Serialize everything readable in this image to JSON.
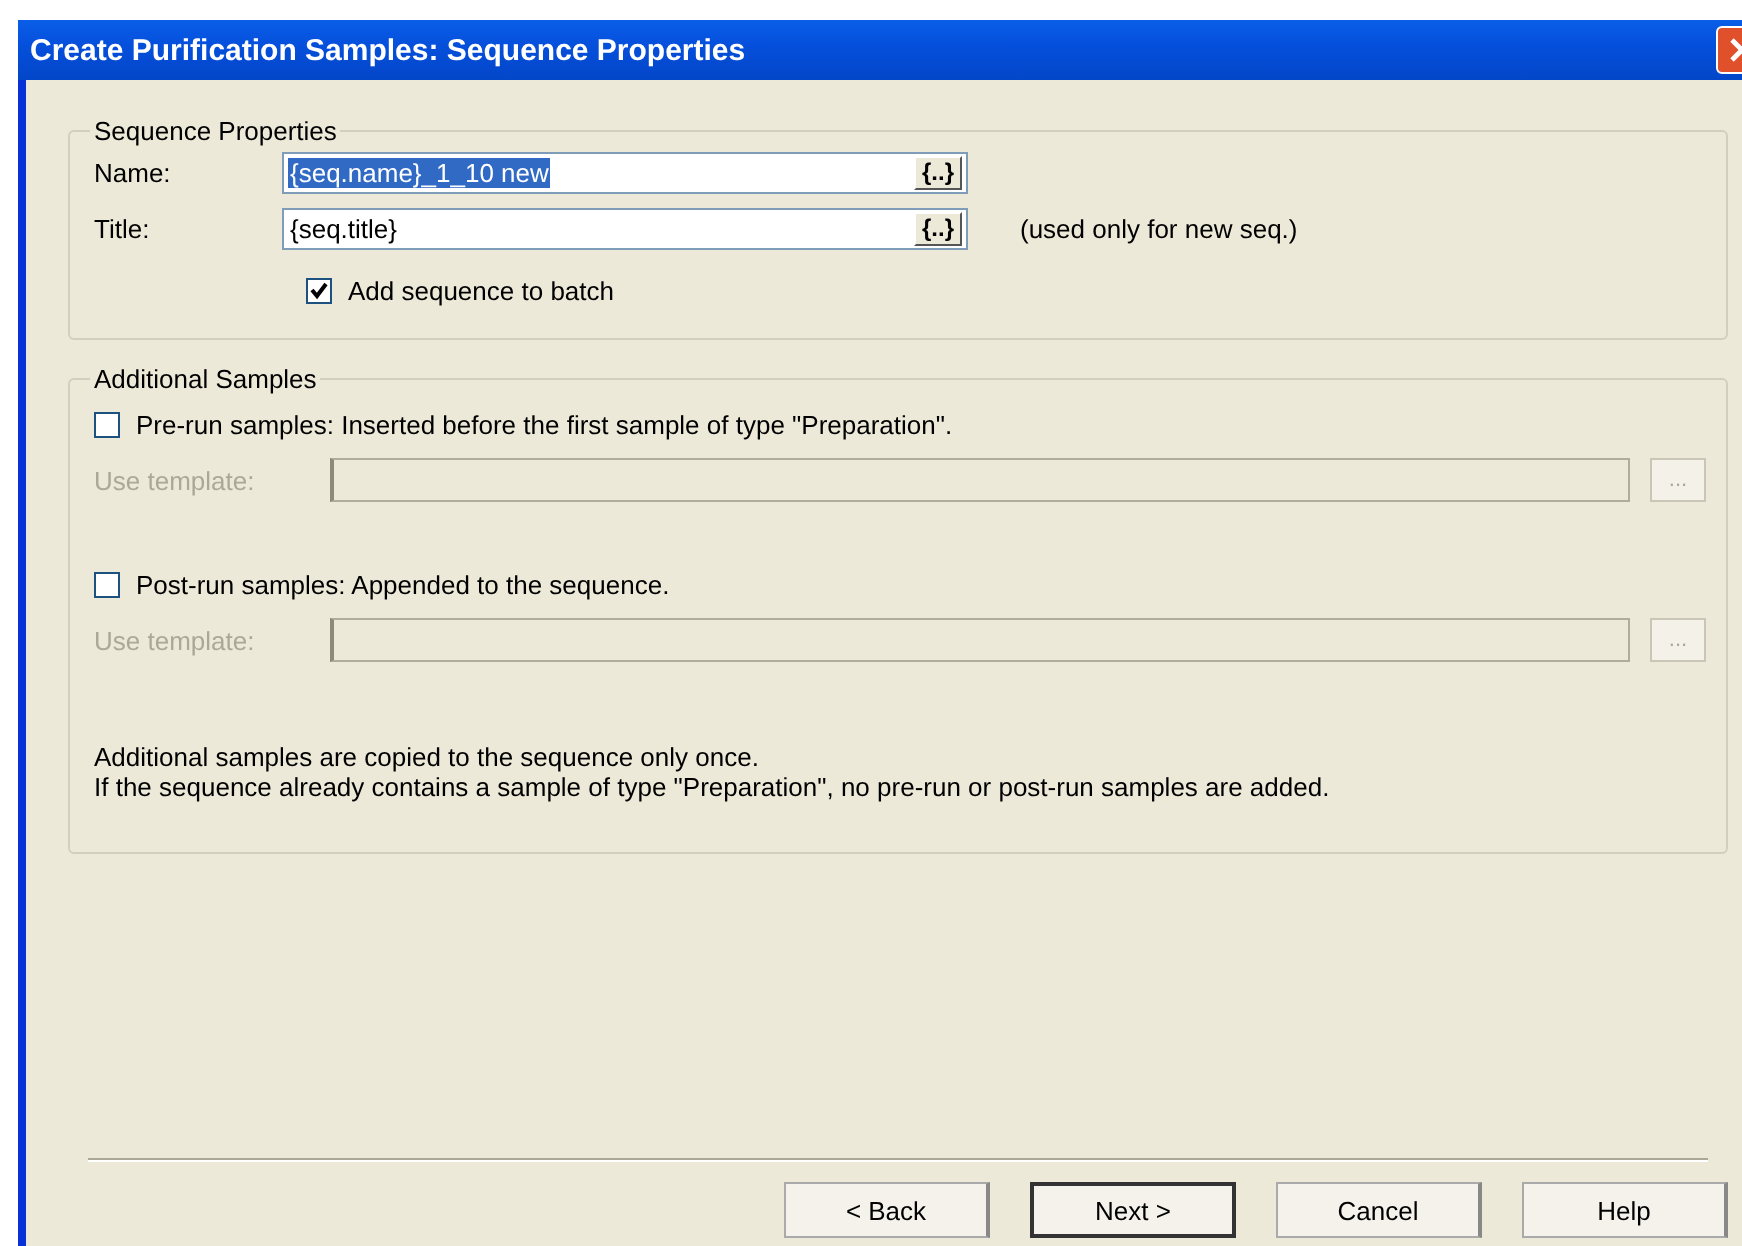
{
  "window": {
    "title": "Create Purification Samples: Sequence Properties"
  },
  "sequence_properties": {
    "legend": "Sequence Properties",
    "fields": [
      {
        "label": "Name:",
        "value": "{seq.name}_1_10 new",
        "highlighted": true,
        "button": "{..}"
      },
      {
        "label": "Title:",
        "value": "{seq.title}",
        "highlighted": false,
        "button": "{..}",
        "note": "(used only for new seq.)"
      }
    ],
    "add_to_batch": {
      "label": "Add sequence to batch",
      "checked": true
    }
  },
  "additional_samples": {
    "legend": "Additional Samples",
    "options": [
      {
        "label": "Pre-run samples: Inserted before the first sample of type \"Preparation\".",
        "checked": false,
        "template_label": "Use template:",
        "disabled": true,
        "browse": "..."
      },
      {
        "label": "Post-run samples: Appended to the sequence.",
        "checked": false,
        "template_label": "Use template:",
        "disabled": true,
        "browse": "..."
      }
    ],
    "notes": [
      "Additional samples are copied to the sequence only once.",
      "If the sequence already contains a sample of type \"Preparation\", no pre-run or post-run samples are added."
    ]
  },
  "buttons": [
    {
      "label": "< Back",
      "default": false
    },
    {
      "label": "Next >",
      "default": true
    },
    {
      "label": "Cancel",
      "default": false
    },
    {
      "label": "Help",
      "default": false
    }
  ]
}
